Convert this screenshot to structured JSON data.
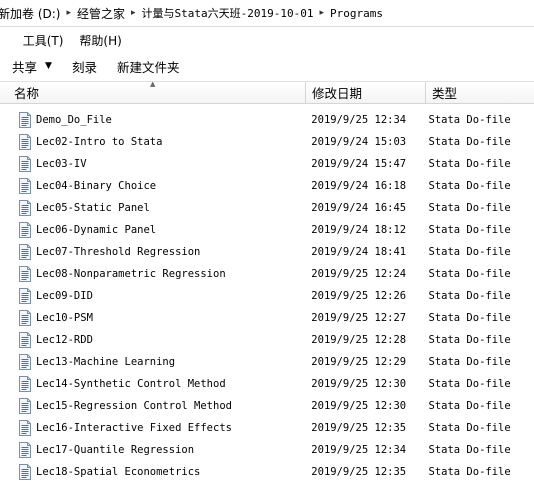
{
  "address": {
    "crumbs": [
      "新加卷 (D:)",
      "经管之家",
      "计量与Stata六天班-2019-10-01",
      "Programs"
    ]
  },
  "menu": {
    "partial_label": ")",
    "tools_label": "工具(T)",
    "help_label": "帮助(H)"
  },
  "toolbar": {
    "share_label": "共享",
    "burn_label": "刻录",
    "new_folder_label": "新建文件夹"
  },
  "columns": {
    "name": "名称",
    "date": "修改日期",
    "type": "类型"
  },
  "files": [
    {
      "name": "Demo_Do_File",
      "date": "2019/9/25 12:34",
      "type": "Stata Do-file"
    },
    {
      "name": "Lec02-Intro to Stata",
      "date": "2019/9/24 15:03",
      "type": "Stata Do-file"
    },
    {
      "name": "Lec03-IV",
      "date": "2019/9/24 15:47",
      "type": "Stata Do-file"
    },
    {
      "name": "Lec04-Binary Choice",
      "date": "2019/9/24 16:18",
      "type": "Stata Do-file"
    },
    {
      "name": "Lec05-Static Panel",
      "date": "2019/9/24 16:45",
      "type": "Stata Do-file"
    },
    {
      "name": "Lec06-Dynamic Panel",
      "date": "2019/9/24 18:12",
      "type": "Stata Do-file"
    },
    {
      "name": "Lec07-Threshold Regression",
      "date": "2019/9/24 18:41",
      "type": "Stata Do-file"
    },
    {
      "name": "Lec08-Nonparametric Regression",
      "date": "2019/9/25 12:24",
      "type": "Stata Do-file"
    },
    {
      "name": "Lec09-DID",
      "date": "2019/9/25 12:26",
      "type": "Stata Do-file"
    },
    {
      "name": "Lec10-PSM",
      "date": "2019/9/25 12:27",
      "type": "Stata Do-file"
    },
    {
      "name": "Lec12-RDD",
      "date": "2019/9/25 12:28",
      "type": "Stata Do-file"
    },
    {
      "name": "Lec13-Machine Learning",
      "date": "2019/9/25 12:29",
      "type": "Stata Do-file"
    },
    {
      "name": "Lec14-Synthetic Control Method",
      "date": "2019/9/25 12:30",
      "type": "Stata Do-file"
    },
    {
      "name": "Lec15-Regression Control Method",
      "date": "2019/9/25 12:30",
      "type": "Stata Do-file"
    },
    {
      "name": "Lec16-Interactive Fixed Effects",
      "date": "2019/9/25 12:35",
      "type": "Stata Do-file"
    },
    {
      "name": "Lec17-Quantile Regression",
      "date": "2019/9/25 12:34",
      "type": "Stata Do-file"
    },
    {
      "name": "Lec18-Spatial Econometrics",
      "date": "2019/9/25 12:35",
      "type": "Stata Do-file"
    }
  ],
  "colors": {
    "icon_fill": "#f2f6fb",
    "icon_stroke": "#7a8fa8",
    "icon_lines": "#5d6f86"
  }
}
